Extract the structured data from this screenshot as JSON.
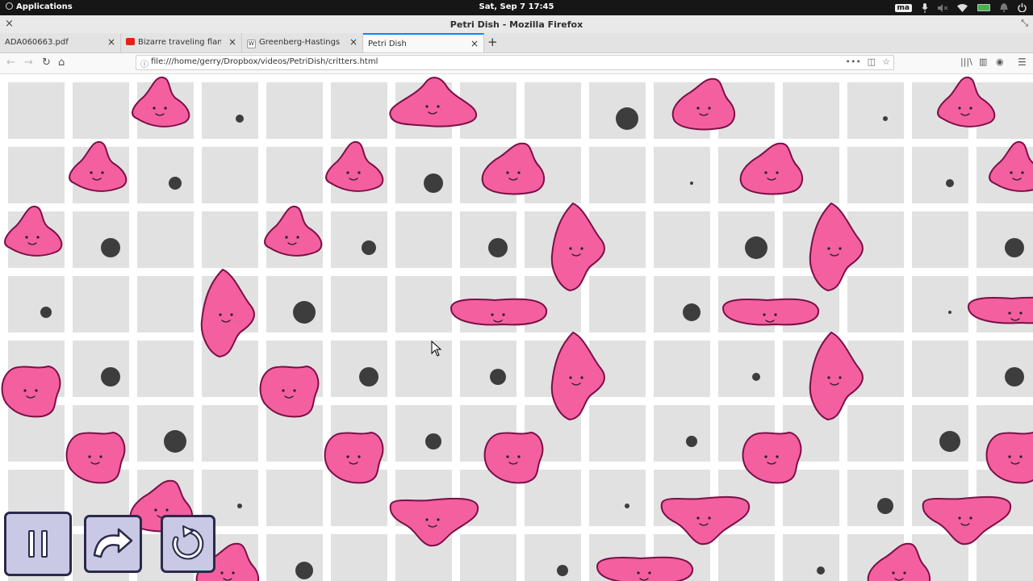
{
  "system_bar": {
    "apps_label": "Applications",
    "clock": "Sat, Sep 7   17:45",
    "keyboard_layout": "ma"
  },
  "window": {
    "title": "Petri Dish - Mozilla Firefox"
  },
  "tabs": [
    {
      "label": "ADA060663.pdf",
      "favicon": "pdf-icon",
      "active": false
    },
    {
      "label": "Bizarre traveling flame disco",
      "favicon": "youtube-icon",
      "active": false
    },
    {
      "label": "Greenberg-Hastings cellular",
      "favicon": "wikipedia-icon",
      "active": false
    },
    {
      "label": "Petri Dish",
      "favicon": "none",
      "active": true
    }
  ],
  "navbar": {
    "url": "file:///home/gerry/Dropbox/videos/PetriDish/critters.html"
  },
  "colors": {
    "critter_fill": "#f45fa0",
    "critter_stroke": "#7a1045",
    "cell_bg": "#e1e1e1",
    "grid_line": "#ffffff",
    "dot": "#3d3d3d",
    "button_bg": "#c9c9e6",
    "button_border": "#2a2a4a"
  },
  "controls": [
    {
      "name": "pause-button",
      "icon": "pause-icon"
    },
    {
      "name": "step-button",
      "icon": "redo-arrow-icon"
    },
    {
      "name": "reset-button",
      "icon": "reset-icon"
    }
  ]
}
